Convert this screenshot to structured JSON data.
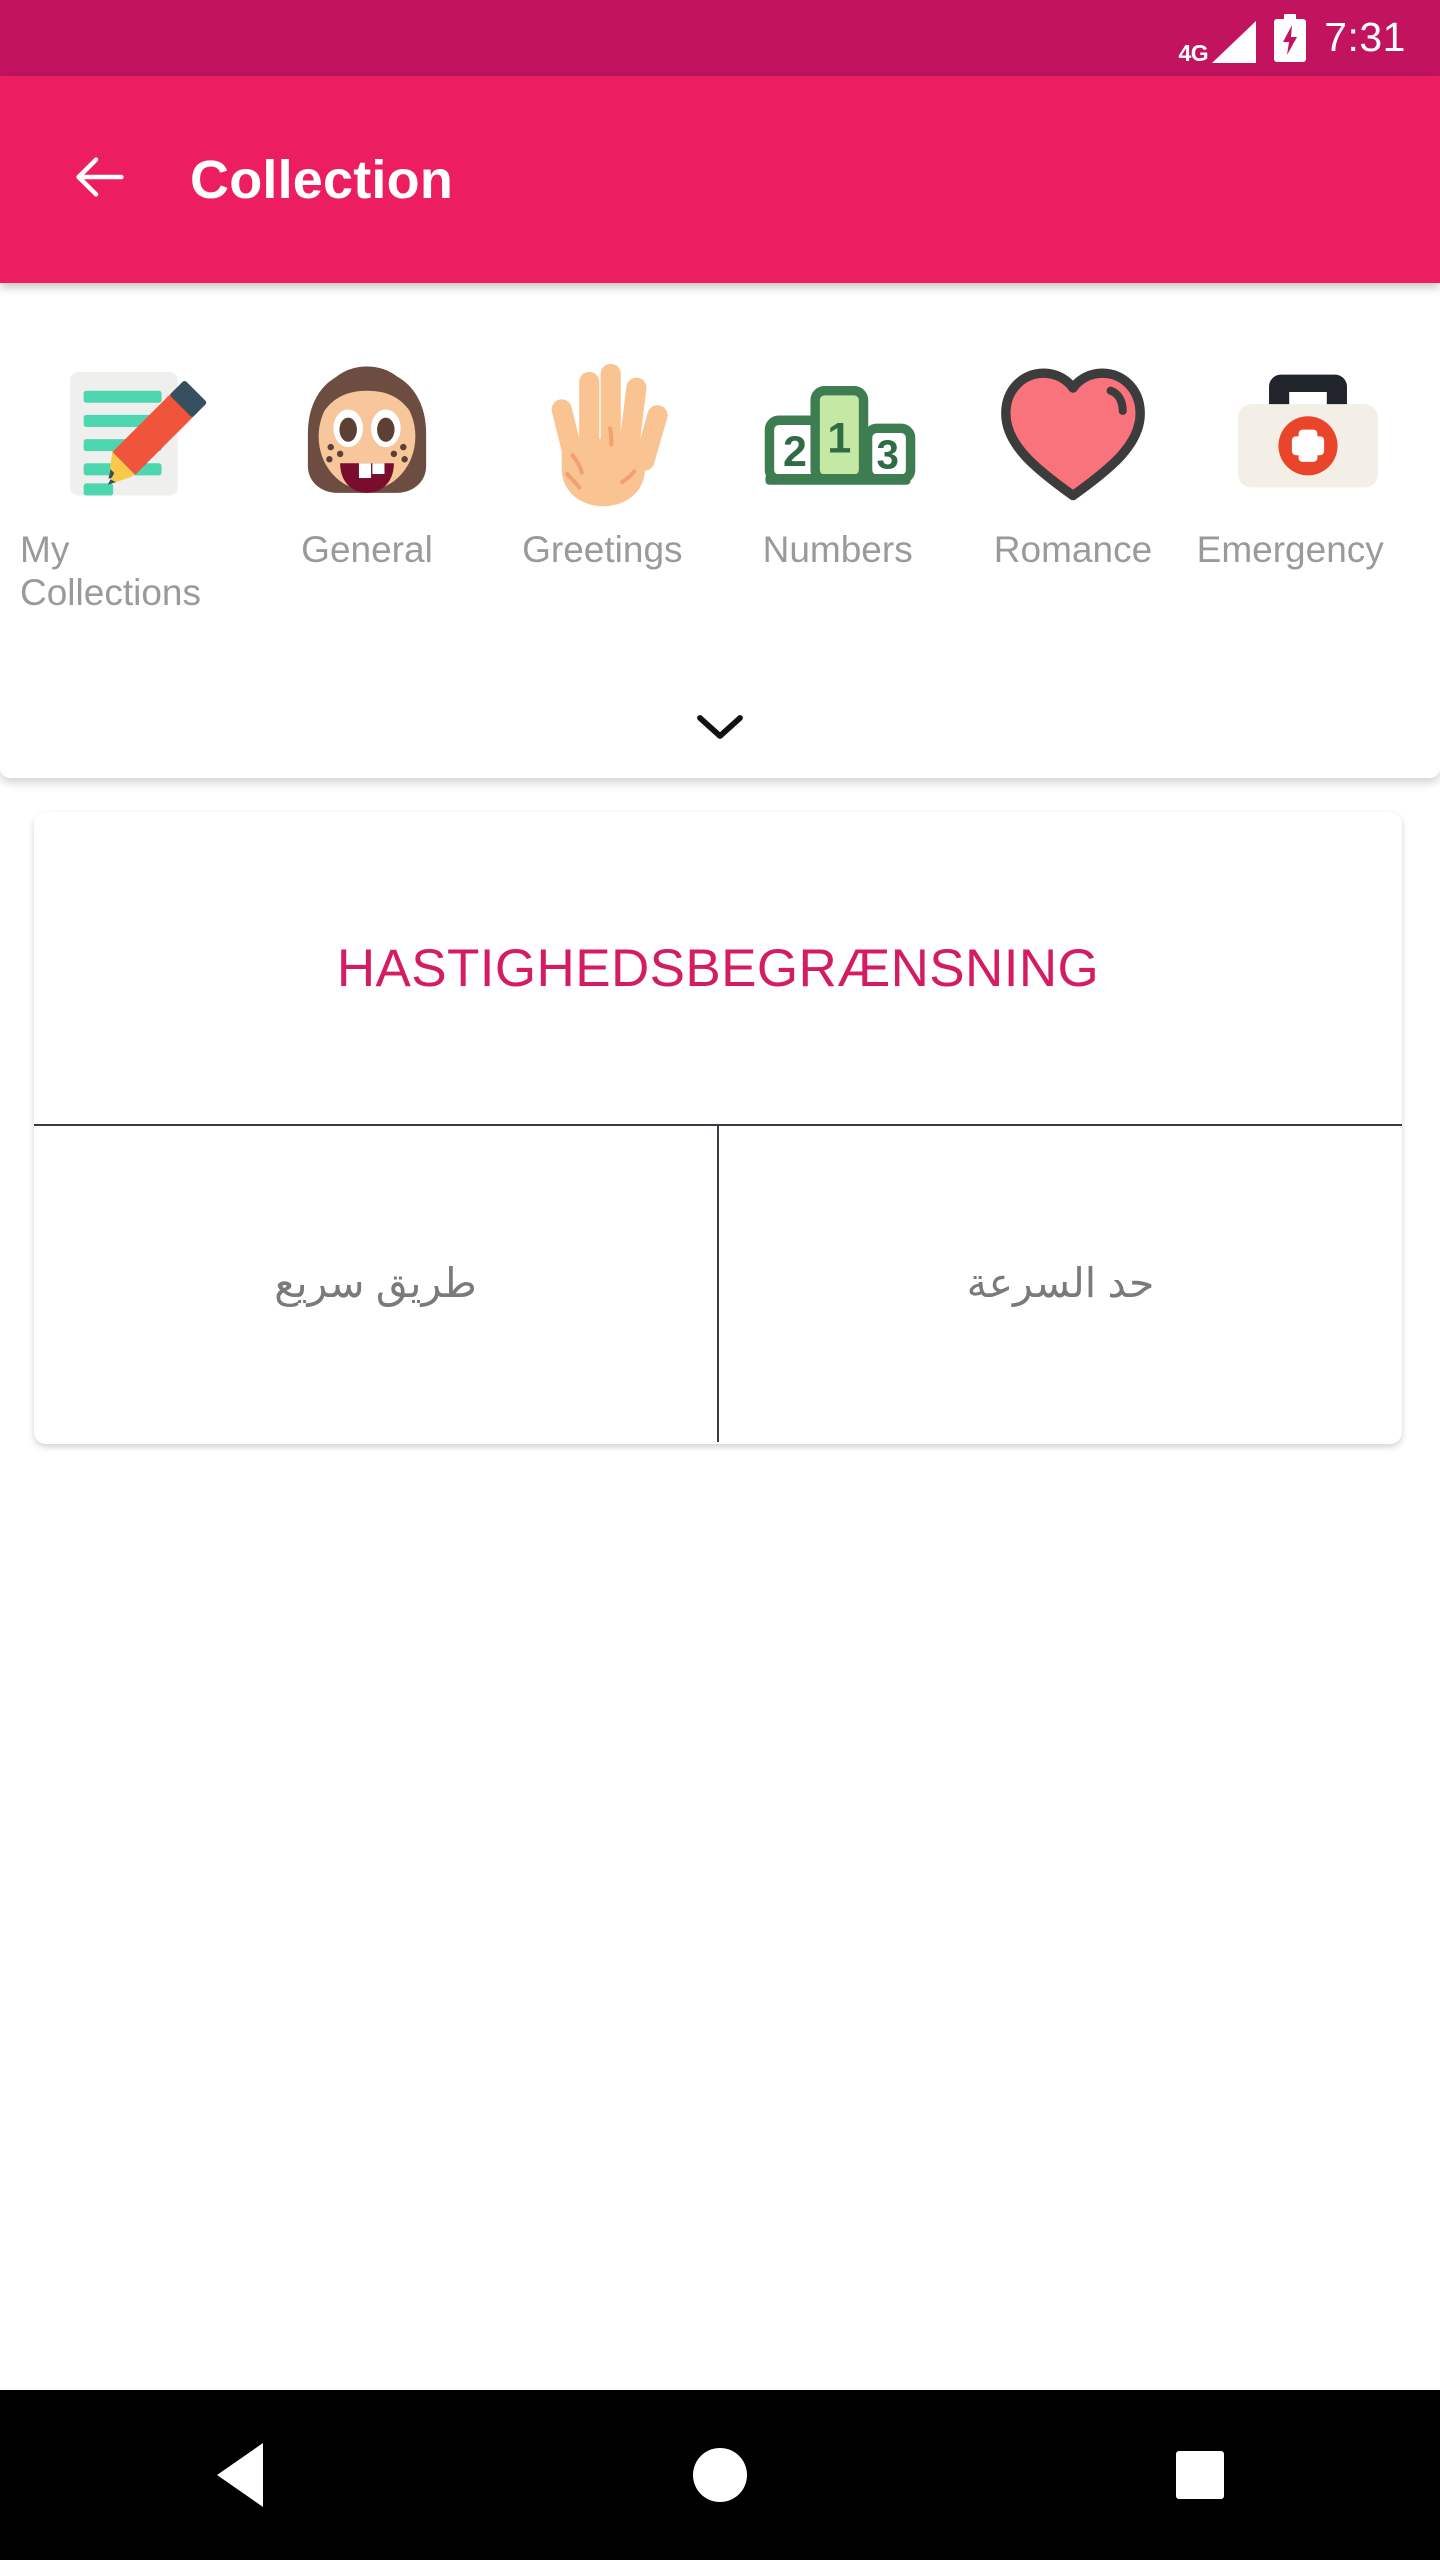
{
  "status_bar": {
    "network_label": "4G",
    "signal_icon": "signal-triangle-icon",
    "battery_icon": "battery-charging-icon",
    "time": "7:31",
    "background_color": "#C2135F"
  },
  "app_bar": {
    "back_icon": "arrow-left-icon",
    "title": "Collection",
    "background_color": "#ED1E5F"
  },
  "categories": {
    "expand_icon": "chevron-down-icon",
    "items": [
      {
        "label": "My Collections",
        "icon": "memo-pencil-icon",
        "selected": true
      },
      {
        "label": "General",
        "icon": "girl-face-icon",
        "selected": false
      },
      {
        "label": "Greetings",
        "icon": "raised-hand-icon",
        "selected": false
      },
      {
        "label": "Numbers",
        "icon": "podium-123-icon",
        "selected": false
      },
      {
        "label": "Romance",
        "icon": "heart-icon",
        "selected": false
      },
      {
        "label": "Emergency",
        "icon": "first-aid-kit-icon",
        "selected": false
      }
    ]
  },
  "phrase_card": {
    "headline": "HASTIGHEDSBEGRÆNSNING",
    "headline_color": "#D31C63",
    "translations": [
      {
        "text": "طريق سريع"
      },
      {
        "text": "حد السرعة"
      }
    ]
  },
  "nav_bar": {
    "back_icon": "nav-back-triangle-icon",
    "home_icon": "nav-home-circle-icon",
    "recents_icon": "nav-recents-square-icon"
  }
}
